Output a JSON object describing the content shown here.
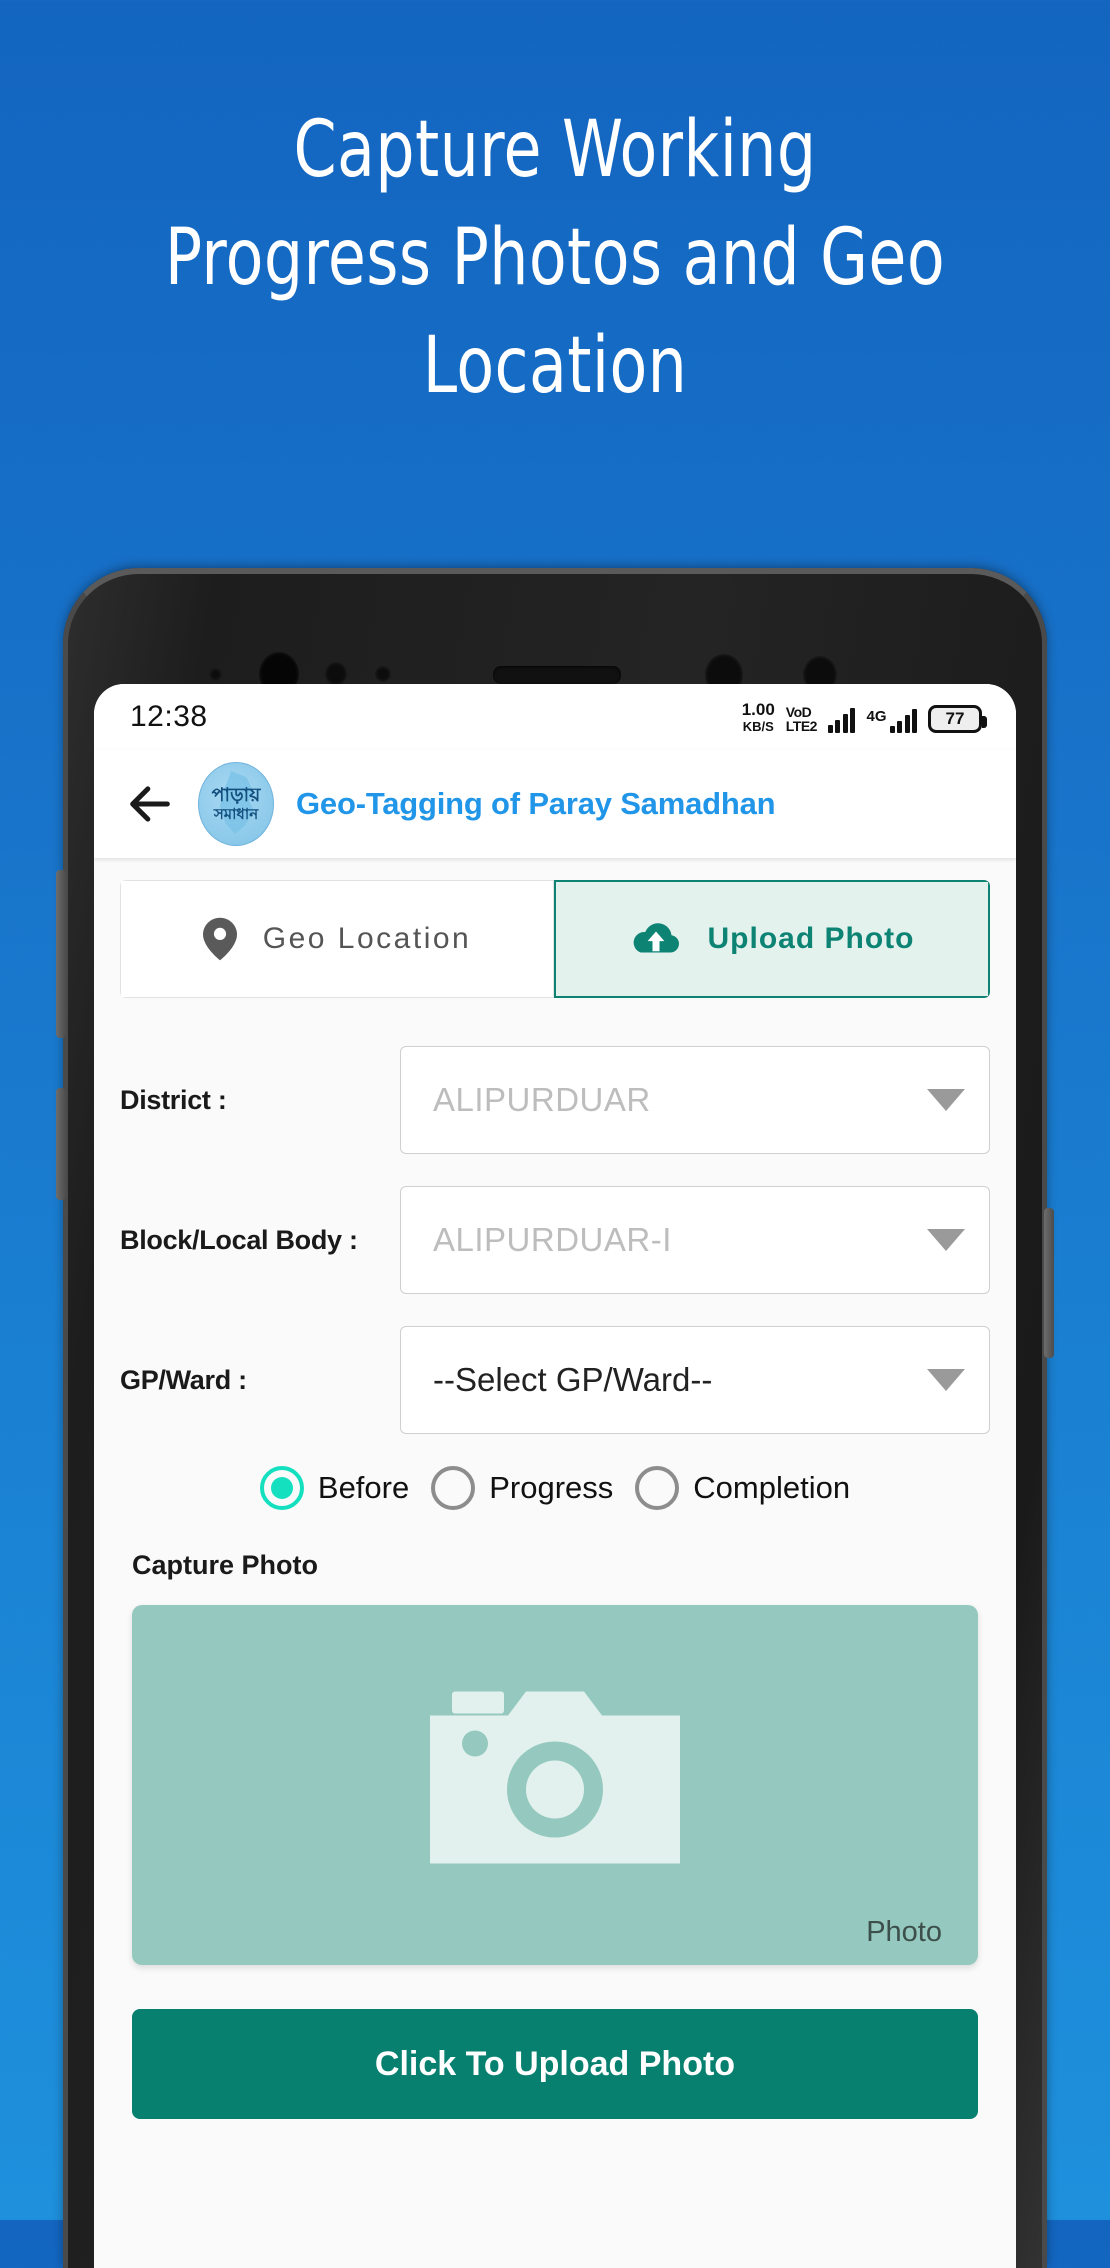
{
  "hero": {
    "lines": [
      "Capture Working",
      "Progress Photos and Geo",
      "Location"
    ],
    "text_color": "#ffffff",
    "background_top": "#1365c0",
    "background_bottom": "#1e90dc"
  },
  "statusbar": {
    "time": "12:38",
    "netspeed_value": "1.00",
    "netspeed_unit": "KB/S",
    "volte_line1": "VoD",
    "volte_line2": "LTE2",
    "network_type": "4G",
    "network_plus": "+",
    "battery_percent": "77"
  },
  "appbar": {
    "back_label": "",
    "logo_line1": "পাড়ায়",
    "logo_line2": "সমাধান",
    "title": "Geo-Tagging of Paray Samadhan",
    "title_color": "#2196e8"
  },
  "tabs": [
    {
      "label": "Geo Location",
      "icon": "map-pin-icon",
      "active": false
    },
    {
      "label": "Upload Photo",
      "icon": "cloud-upload-icon",
      "active": true
    }
  ],
  "accent": {
    "teal": "#0d8374",
    "teal_button": "#088070",
    "radio_on": "#14e0c0",
    "placeholder_bg": "#95c9bf"
  },
  "form": {
    "district": {
      "label": "District :",
      "value": "ALIPURDUAR",
      "disabled": true
    },
    "block": {
      "label": "Block/Local Body :",
      "value": "ALIPURDUAR-I",
      "disabled": true
    },
    "gpward": {
      "label": "GP/Ward :",
      "value": "--Select GP/Ward--",
      "disabled": false
    }
  },
  "stage_radios": [
    {
      "label": "Before",
      "selected": true
    },
    {
      "label": "Progress",
      "selected": false
    },
    {
      "label": "Completion",
      "selected": false
    }
  ],
  "capture": {
    "section_label": "Capture Photo",
    "placeholder_tag": "Photo",
    "upload_button": "Click To Upload Photo"
  }
}
